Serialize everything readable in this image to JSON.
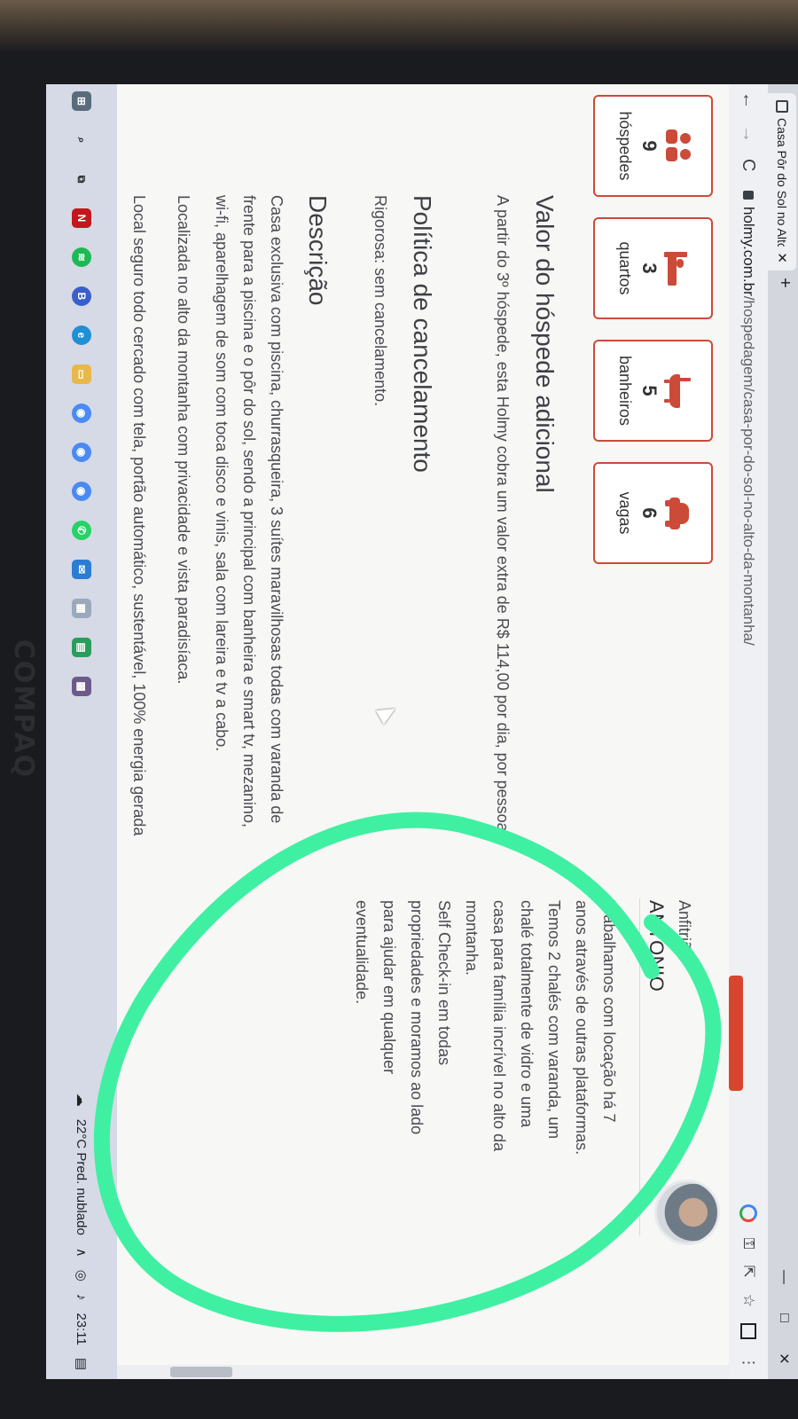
{
  "browser": {
    "tab_title": "Casa Pôr do Sol no Alto da Mon",
    "tab_close": "✕",
    "new_tab": "+",
    "url_domain": "holmy.com.br",
    "url_path": "/hospedagem/casa-por-do-sol-no-alto-da-montanha/",
    "back": "←",
    "forward": "→",
    "reload": "C",
    "window_buttons": [
      "—",
      "□",
      "✕"
    ]
  },
  "stats": [
    {
      "icon": "guests-icon",
      "value": "9",
      "label": "hóspedes"
    },
    {
      "icon": "bed-icon",
      "value": "3",
      "label": "quartos"
    },
    {
      "icon": "bathtub-icon",
      "value": "5",
      "label": "banheiros"
    },
    {
      "icon": "car-icon",
      "value": "6",
      "label": "vagas"
    }
  ],
  "extra_guest": {
    "title": "Valor do hóspede adicional",
    "text": "A partir do 3º hóspede, esta Holmy cobra um valor extra de R$ 114,00 por dia, por pessoa."
  },
  "cancellation": {
    "title": "Política de cancelamento",
    "text": "Rigorosa: sem cancelamento."
  },
  "description": {
    "title": "Descrição",
    "p1_line1": "Casa exclusiva com piscina, churrasqueira, 3 suítes maravilhosas todas com varanda de",
    "p1_line2": "frente para a piscina e o pôr do sol, sendo a principal com banheira e smart tv, mezanino,",
    "p1_line3": "wi-fi, aparelhagem de som com toca disco e vinis, sala com lareira e tv a cabo.",
    "p2": "Localizada no alto da montanha com privacidade e vista paradisíaca.",
    "p3": "Local seguro todo cercado com tela, portão automático, sustentável, 100% energia gerada"
  },
  "host": {
    "role": "Anfitrião",
    "name": "ANTONIO",
    "bio": [
      "Trabalhamos com locação há 7",
      "anos através de outras plataformas.",
      "Temos 2 chalés com varanda, um",
      "chalé totalmente de vidro e uma",
      "casa para família incrível no alto da",
      "montanha.",
      "Self Check-in em todas",
      "propriedades e moramos ao lado",
      "para ajudar em qualquer",
      "eventualidade."
    ]
  },
  "taskbar": {
    "weather": "22°C  Pred. nublado",
    "clock": "23:11"
  },
  "monitor_brand": "COMPAQ",
  "colors": {
    "accent": "#cc4a38",
    "highlight": "#3ff0a2"
  }
}
